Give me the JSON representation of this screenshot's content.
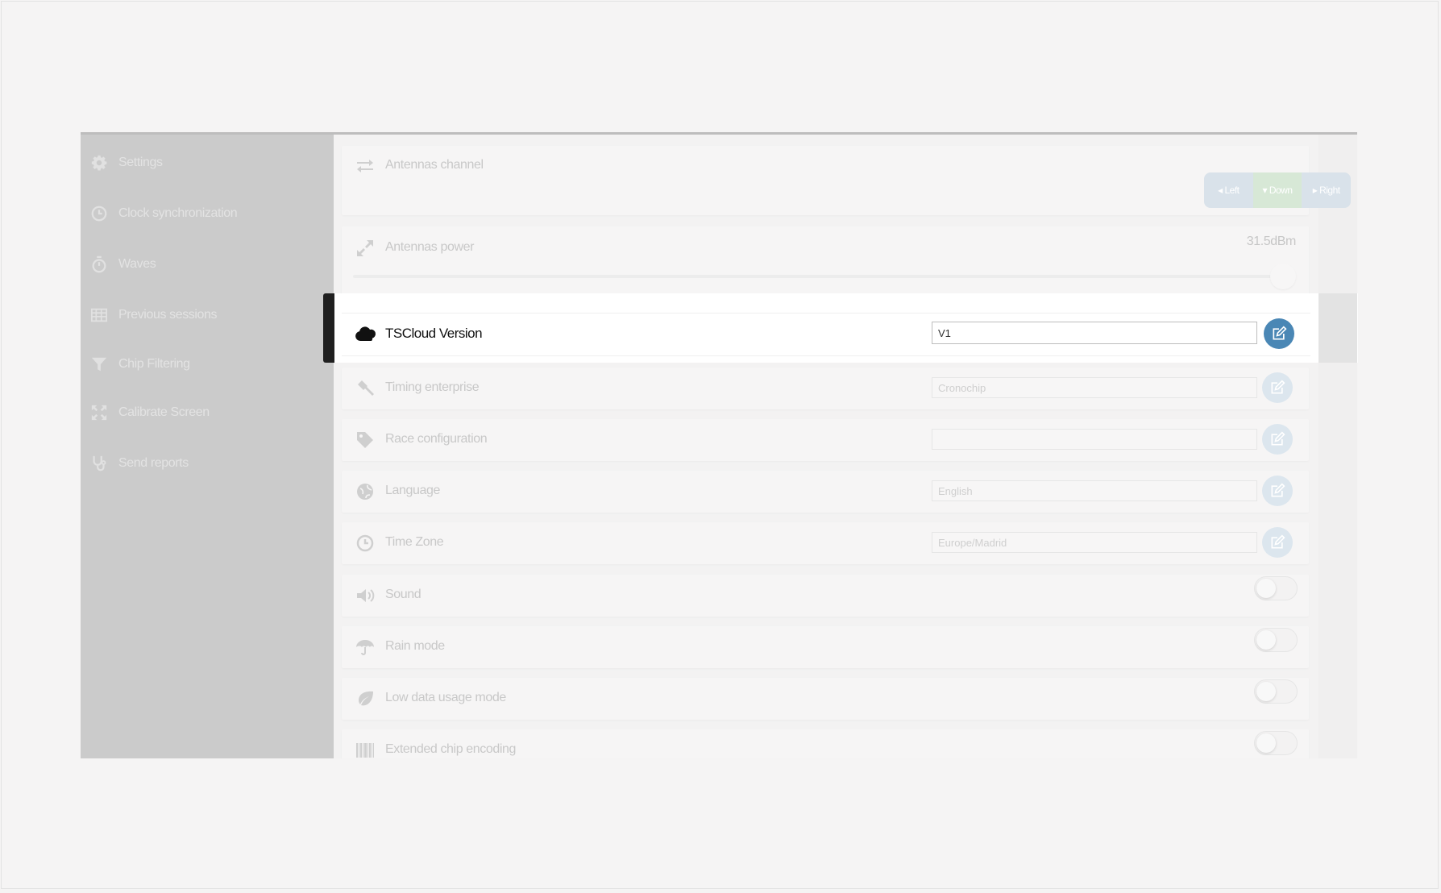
{
  "sidebar": {
    "items": [
      {
        "label": "Settings",
        "icon": "gear-icon"
      },
      {
        "label": "Clock synchronization",
        "icon": "clock-icon"
      },
      {
        "label": "Waves",
        "icon": "stopwatch-icon"
      },
      {
        "label": "Previous sessions",
        "icon": "table-icon"
      },
      {
        "label": "Chip Filtering",
        "icon": "filter-icon"
      },
      {
        "label": "Calibrate Screen",
        "icon": "expand-arrows-icon"
      },
      {
        "label": "Send reports",
        "icon": "stethoscope-icon"
      }
    ]
  },
  "settings": {
    "antennas_channel": {
      "label": "Antennas channel",
      "left": "Left",
      "down": "Down",
      "right": "Right"
    },
    "antennas_power": {
      "label": "Antennas power",
      "value": "31.5dBm",
      "level": 1.0
    },
    "tscloud_version": {
      "label": "TSCloud Version",
      "value": "V1"
    },
    "timing_enterprise": {
      "label": "Timing enterprise",
      "value": "Cronochip"
    },
    "race_configuration": {
      "label": "Race configuration",
      "value": ""
    },
    "language": {
      "label": "Language",
      "value": "English"
    },
    "time_zone": {
      "label": "Time Zone",
      "value": "Europe/Madrid"
    },
    "sound": {
      "label": "Sound",
      "enabled": false
    },
    "rain_mode": {
      "label": "Rain mode",
      "enabled": false
    },
    "low_data_usage_mode": {
      "label": "Low data usage mode",
      "enabled": false
    },
    "extended_chip_encoding": {
      "label": "Extended chip encoding",
      "enabled": false
    }
  },
  "colors": {
    "edit_button_active": "#4a87b5",
    "edit_button_dim": "#dce6ee",
    "sidebar_bg": "#cbcbcb"
  }
}
